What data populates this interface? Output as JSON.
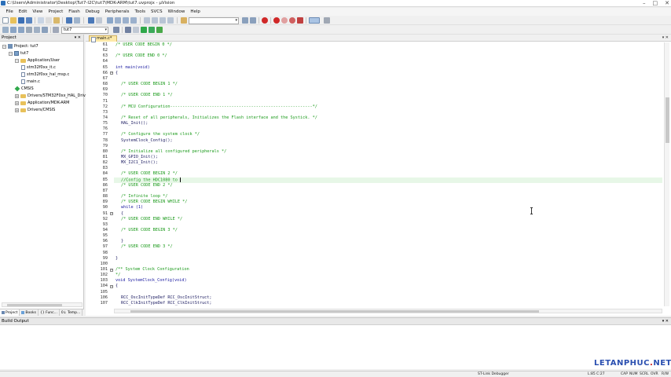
{
  "window": {
    "title": "C:\\Users\\Administrator\\Desktop\\Tut7-I2C\\tut7\\MDK-ARM\\tut7.uvprojx - µVision",
    "controls": [
      "–",
      "□",
      "✕"
    ]
  },
  "menu": [
    "File",
    "Edit",
    "View",
    "Project",
    "Flash",
    "Debug",
    "Peripherals",
    "Tools",
    "SVCS",
    "Window",
    "Help"
  ],
  "toolbar": {
    "target_combo": "tut7",
    "search_combo": ""
  },
  "project_panel": {
    "title": "Project",
    "tree": [
      {
        "label": "Project: tut7",
        "icon": "project-icon",
        "indent": 0,
        "expander": "−"
      },
      {
        "label": "tut7",
        "icon": "target-icon",
        "indent": 1,
        "expander": "−"
      },
      {
        "label": "Application/User",
        "icon": "folder-icon",
        "indent": 2,
        "expander": "−"
      },
      {
        "label": "stm32f0xx_it.c",
        "icon": "file-icon",
        "indent": 3,
        "expander": ""
      },
      {
        "label": "stm32f0xx_hal_msp.c",
        "icon": "file-icon",
        "indent": 3,
        "expander": ""
      },
      {
        "label": "main.c",
        "icon": "file-icon",
        "indent": 3,
        "expander": ""
      },
      {
        "label": "CMSIS",
        "icon": "cmsis-icon",
        "indent": 2,
        "expander": ""
      },
      {
        "label": "Drivers/STM32F0xx_HAL_Driv...",
        "icon": "folder-icon",
        "indent": 2,
        "expander": "+"
      },
      {
        "label": "Application/MDK-ARM",
        "icon": "folder-icon",
        "indent": 2,
        "expander": "+"
      },
      {
        "label": "Drivers/CMSIS",
        "icon": "folder-icon",
        "indent": 2,
        "expander": "+"
      }
    ],
    "tabs": [
      "Project",
      "Books",
      "{} Func...",
      "0↓ Temp..."
    ]
  },
  "editor": {
    "tab_label": "main.c*",
    "lines": [
      {
        "n": "61",
        "text": "/* USER CODE BEGIN 0 */",
        "cls": "comment",
        "indent": 0
      },
      {
        "n": "62",
        "text": "",
        "cls": "plain",
        "indent": 0
      },
      {
        "n": "63",
        "text": "/* USER CODE END 0 */",
        "cls": "comment",
        "indent": 0
      },
      {
        "n": "64",
        "text": "",
        "cls": "plain",
        "indent": 0
      },
      {
        "n": "65",
        "text": "int main(void)",
        "cls": "plain",
        "indent": 0
      },
      {
        "n": "66",
        "text": "{",
        "cls": "plain",
        "indent": 0,
        "fold": "−"
      },
      {
        "n": "67",
        "text": "",
        "cls": "plain",
        "indent": 0
      },
      {
        "n": "68",
        "text": "/* USER CODE BEGIN 1 */",
        "cls": "comment",
        "indent": 1
      },
      {
        "n": "69",
        "text": "",
        "cls": "plain",
        "indent": 0
      },
      {
        "n": "70",
        "text": "/* USER CODE END 1 */",
        "cls": "comment",
        "indent": 1
      },
      {
        "n": "71",
        "text": "",
        "cls": "plain",
        "indent": 0
      },
      {
        "n": "72",
        "text": "/* MCU Configuration----------------------------------------------------------*/",
        "cls": "comment",
        "indent": 1
      },
      {
        "n": "73",
        "text": "",
        "cls": "plain",
        "indent": 0
      },
      {
        "n": "74",
        "text": "/* Reset of all peripherals, Initializes the Flash interface and the Systick. */",
        "cls": "comment",
        "indent": 1
      },
      {
        "n": "75",
        "text": "HAL_Init();",
        "cls": "plain",
        "indent": 1
      },
      {
        "n": "76",
        "text": "",
        "cls": "plain",
        "indent": 0
      },
      {
        "n": "77",
        "text": "/* Configure the system clock */",
        "cls": "comment",
        "indent": 1
      },
      {
        "n": "78",
        "text": "SystemClock_Config();",
        "cls": "plain",
        "indent": 1
      },
      {
        "n": "79",
        "text": "",
        "cls": "plain",
        "indent": 0
      },
      {
        "n": "80",
        "text": "/* Initialize all configured peripherals */",
        "cls": "comment",
        "indent": 1
      },
      {
        "n": "81",
        "text": "MX_GPIO_Init();",
        "cls": "plain",
        "indent": 1
      },
      {
        "n": "82",
        "text": "MX_I2C1_Init();",
        "cls": "plain",
        "indent": 1
      },
      {
        "n": "83",
        "text": "",
        "cls": "plain",
        "indent": 0
      },
      {
        "n": "84",
        "text": "/* USER CODE BEGIN 2 */",
        "cls": "comment",
        "indent": 1
      },
      {
        "n": "85",
        "text": "//Config the HDC1080 to ",
        "cls": "comment",
        "indent": 1,
        "current": true
      },
      {
        "n": "86",
        "text": "/* USER CODE END 2 */",
        "cls": "comment",
        "indent": 1
      },
      {
        "n": "87",
        "text": "",
        "cls": "plain",
        "indent": 0
      },
      {
        "n": "88",
        "text": "/* Infinite loop */",
        "cls": "comment",
        "indent": 1
      },
      {
        "n": "89",
        "text": "/* USER CODE BEGIN WHILE */",
        "cls": "comment",
        "indent": 1
      },
      {
        "n": "90",
        "text": "while (1)",
        "cls": "plain",
        "indent": 1
      },
      {
        "n": "91",
        "text": "{",
        "cls": "plain",
        "indent": 1,
        "fold": "−"
      },
      {
        "n": "92",
        "text": "/* USER CODE END WHILE */",
        "cls": "comment",
        "indent": 1
      },
      {
        "n": "93",
        "text": "",
        "cls": "plain",
        "indent": 0
      },
      {
        "n": "94",
        "text": "/* USER CODE BEGIN 3 */",
        "cls": "comment",
        "indent": 1
      },
      {
        "n": "95",
        "text": "",
        "cls": "plain",
        "indent": 0
      },
      {
        "n": "96",
        "text": "}",
        "cls": "plain",
        "indent": 1
      },
      {
        "n": "97",
        "text": "/* USER CODE END 3 */",
        "cls": "comment",
        "indent": 1
      },
      {
        "n": "98",
        "text": "",
        "cls": "plain",
        "indent": 0
      },
      {
        "n": "99",
        "text": "}",
        "cls": "plain",
        "indent": 0
      },
      {
        "n": "100",
        "text": "",
        "cls": "plain",
        "indent": 0
      },
      {
        "n": "101",
        "text": "/** System Clock Configuration",
        "cls": "comment",
        "indent": 0,
        "fold": "−"
      },
      {
        "n": "102",
        "text": "*/",
        "cls": "comment",
        "indent": 0
      },
      {
        "n": "103",
        "text": "void SystemClock_Config(void)",
        "cls": "plain",
        "indent": 0
      },
      {
        "n": "104",
        "text": "{",
        "cls": "plain",
        "indent": 0,
        "fold": "−"
      },
      {
        "n": "105",
        "text": "",
        "cls": "plain",
        "indent": 0
      },
      {
        "n": "106",
        "text": "RCC_OscInitTypeDef RCC_OscInitStruct;",
        "cls": "plain",
        "indent": 1
      },
      {
        "n": "107",
        "text": "RCC_ClkInitTypeDef RCC_ClkInitStruct;",
        "cls": "plain",
        "indent": 1
      }
    ]
  },
  "build_output": {
    "title": "Build Output"
  },
  "watermark": {
    "text": "LETANPHUC",
    "dot": ".",
    "suffix": "NET"
  },
  "statusbar": {
    "debugger": "ST-Link Debugger",
    "position": "L:85 C:27",
    "cap": "CAP",
    "num": "NUM",
    "scrl": "SCRL",
    "ovr": "OVR",
    "rw": "R/W"
  }
}
